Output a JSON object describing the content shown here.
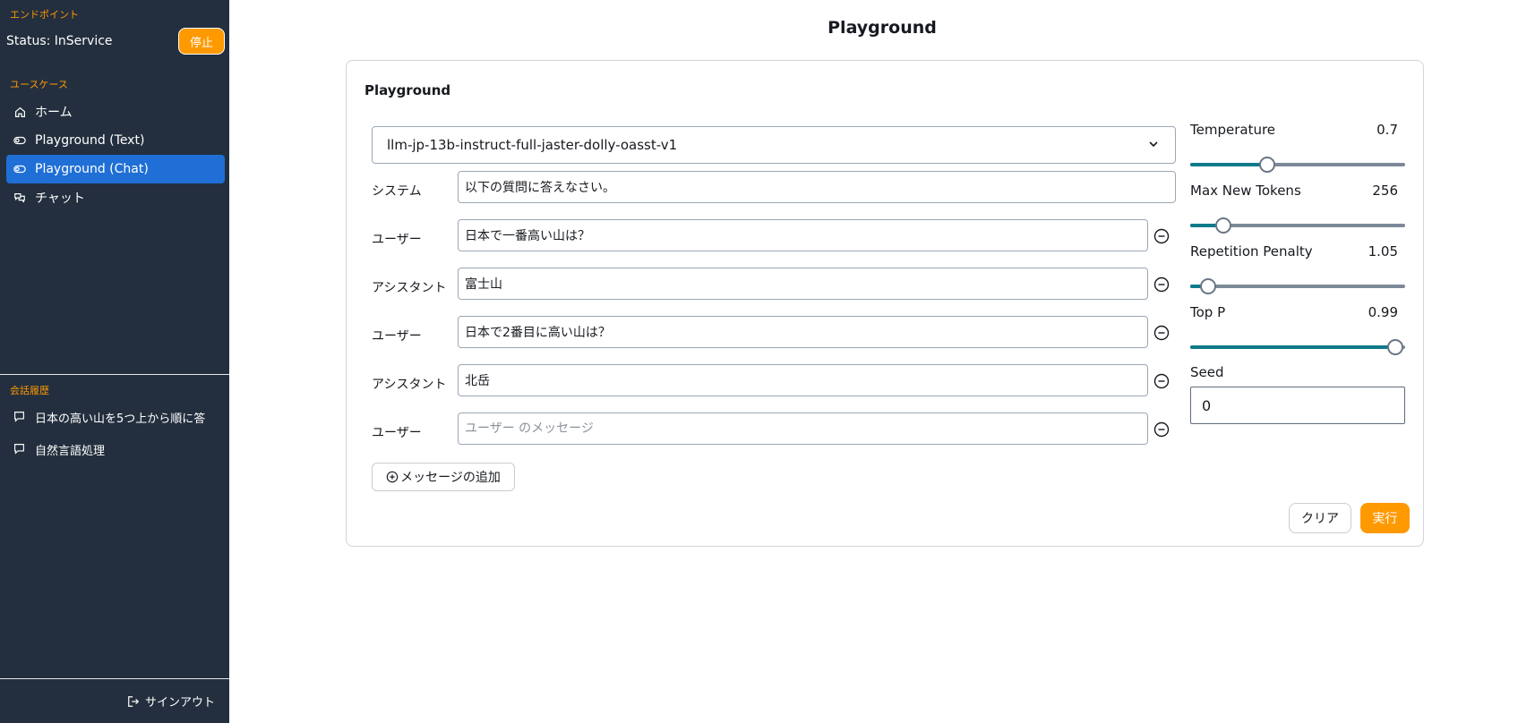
{
  "sidebar": {
    "endpoint_label": "エンドポイント",
    "status_text": "Status: InService",
    "stop_label": "停止",
    "usecase_label": "ユースケース",
    "nav": [
      {
        "label": "ホーム",
        "icon": "home-icon"
      },
      {
        "label": "Playground (Text)",
        "icon": "toggle-icon"
      },
      {
        "label": "Playground (Chat)",
        "icon": "toggle-icon",
        "active": true
      },
      {
        "label": "チャット",
        "icon": "chat-bubbles-icon"
      }
    ],
    "history_label": "会話履歴",
    "history": [
      {
        "label": "日本の高い山を5つ上から順に答",
        "icon": "message-icon"
      },
      {
        "label": "自然言語処理",
        "icon": "message-icon"
      }
    ],
    "signout_label": "サインアウト"
  },
  "main": {
    "page_title": "Playground",
    "card_title": "Playground",
    "model": "llm-jp-13b-instruct-full-jaster-dolly-oasst-v1",
    "system_role": "システム",
    "system_prompt": "以下の質問に答えなさい。",
    "messages": [
      {
        "role": "ユーザー",
        "content": "日本で一番高い山は？"
      },
      {
        "role": "アシスタント",
        "content": "富士山"
      },
      {
        "role": "ユーザー",
        "content": "日本で2番目に高い山は？"
      },
      {
        "role": "アシスタント",
        "content": "北岳"
      },
      {
        "role": "ユーザー",
        "content": "",
        "placeholder": "ユーザー のメッセージ"
      }
    ],
    "add_message_label": "メッセージの追加",
    "clear_label": "クリア",
    "run_label": "実行"
  },
  "params": [
    {
      "label": "Temperature",
      "value": "0.7",
      "fraction": 0.36
    },
    {
      "label": "Max New Tokens",
      "value": "256",
      "fraction": 0.155
    },
    {
      "label": "Repetition Penalty",
      "value": "1.05",
      "fraction": 0.085
    },
    {
      "label": "Top P",
      "value": "0.99",
      "fraction": 0.955
    }
  ],
  "seed": {
    "label": "Seed",
    "value": "0"
  },
  "colors": {
    "sidebar_bg": "#232f3e",
    "accent": "#ff9900",
    "active_nav": "#1f6fd6",
    "slider_fill": "#0f7a8a"
  }
}
